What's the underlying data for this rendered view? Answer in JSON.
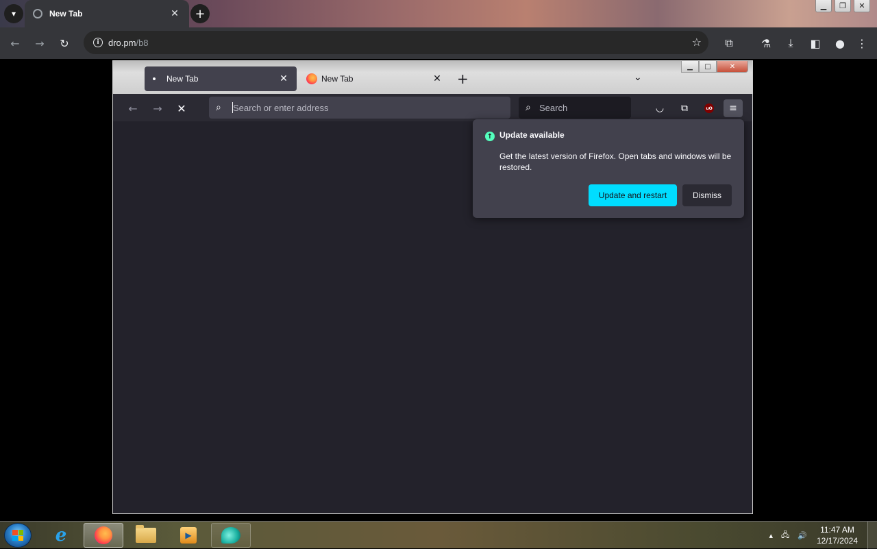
{
  "chrome": {
    "tab_title": "New Tab",
    "url_host": "dro.pm",
    "url_path": "/b8"
  },
  "firefox": {
    "tabs": [
      {
        "label": "New Tab"
      },
      {
        "label": "New Tab"
      }
    ],
    "urlbar_placeholder": "Search or enter address",
    "search_placeholder": "Search",
    "update": {
      "title": "Update available",
      "body": "Get the latest version of Firefox. Open tabs and windows will be restored.",
      "primary_label": "Update and restart",
      "secondary_label": "Dismiss"
    }
  },
  "taskbar": {
    "time": "11:47 AM",
    "date": "12/17/2024"
  },
  "colors": {
    "accent": "#00ddff",
    "update_icon": "#54ffbd"
  }
}
